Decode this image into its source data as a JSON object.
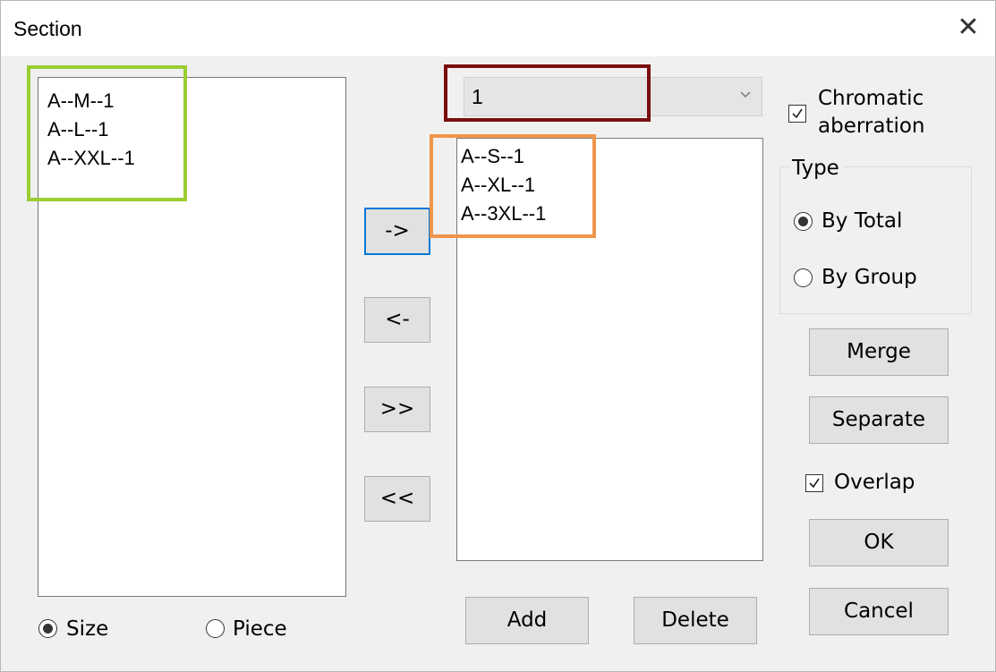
{
  "window": {
    "title": "Section",
    "close_glyph": "✕"
  },
  "left_list": {
    "items": [
      "A--M--1",
      "A--L--1",
      "A--XXL--1"
    ]
  },
  "right_list": {
    "items": [
      "A--S--1",
      "A--XL--1",
      "A--3XL--1"
    ]
  },
  "combo": {
    "value": "1"
  },
  "transfer_buttons": {
    "move_right": "->",
    "move_left": "<-",
    "move_all_right": ">>",
    "move_all_left": "<<"
  },
  "chromatic": {
    "label_line1": "Chromatic",
    "label_line2": "aberration",
    "checked": true
  },
  "type_group": {
    "title": "Type",
    "options": [
      "By Total",
      "By Group"
    ],
    "selected": "By Total"
  },
  "actions": {
    "merge": "Merge",
    "separate": "Separate",
    "ok": "OK",
    "cancel": "Cancel",
    "add": "Add",
    "delete": "Delete"
  },
  "overlap": {
    "label": "Overlap",
    "checked": true
  },
  "mode": {
    "options": [
      "Size",
      "Piece"
    ],
    "selected": "Size"
  },
  "highlight_colors": {
    "left_list": "#9acd32",
    "combo": "#7b0e0e",
    "right_list": "#f0944a",
    "focus": "#0078d7"
  }
}
